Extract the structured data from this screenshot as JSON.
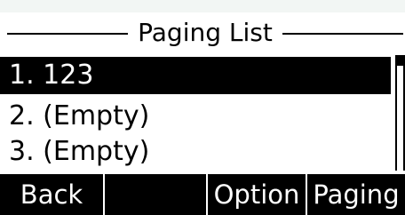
{
  "title": "Paging List",
  "list": {
    "items": [
      {
        "label": "1. 123",
        "selected": true
      },
      {
        "label": "2. (Empty)",
        "selected": false
      },
      {
        "label": "3. (Empty)",
        "selected": false
      }
    ]
  },
  "softkeys": {
    "back": "Back",
    "blank": "",
    "option": "Option",
    "paging": "Paging"
  },
  "colors": {
    "background": "#ffffff",
    "foreground": "#000000",
    "highlight": "#000000",
    "highlight_text": "#ffffff"
  }
}
